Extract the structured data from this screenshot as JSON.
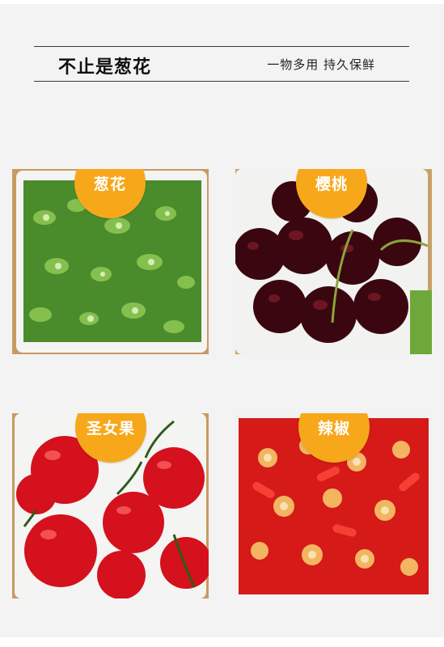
{
  "header": {
    "title": "不止是葱花",
    "subtitle": "一物多用 持久保鲜"
  },
  "items": [
    {
      "label": "葱花",
      "icon": "green-onion-photo"
    },
    {
      "label": "樱桃",
      "icon": "cherry-photo"
    },
    {
      "label": "圣女果",
      "icon": "cherry-tomato-photo"
    },
    {
      "label": "辣椒",
      "icon": "chili-pepper-photo"
    }
  ],
  "colors": {
    "badge": "#f6a81a",
    "background": "#f3f3f3",
    "rule": "#3a3a3a"
  }
}
